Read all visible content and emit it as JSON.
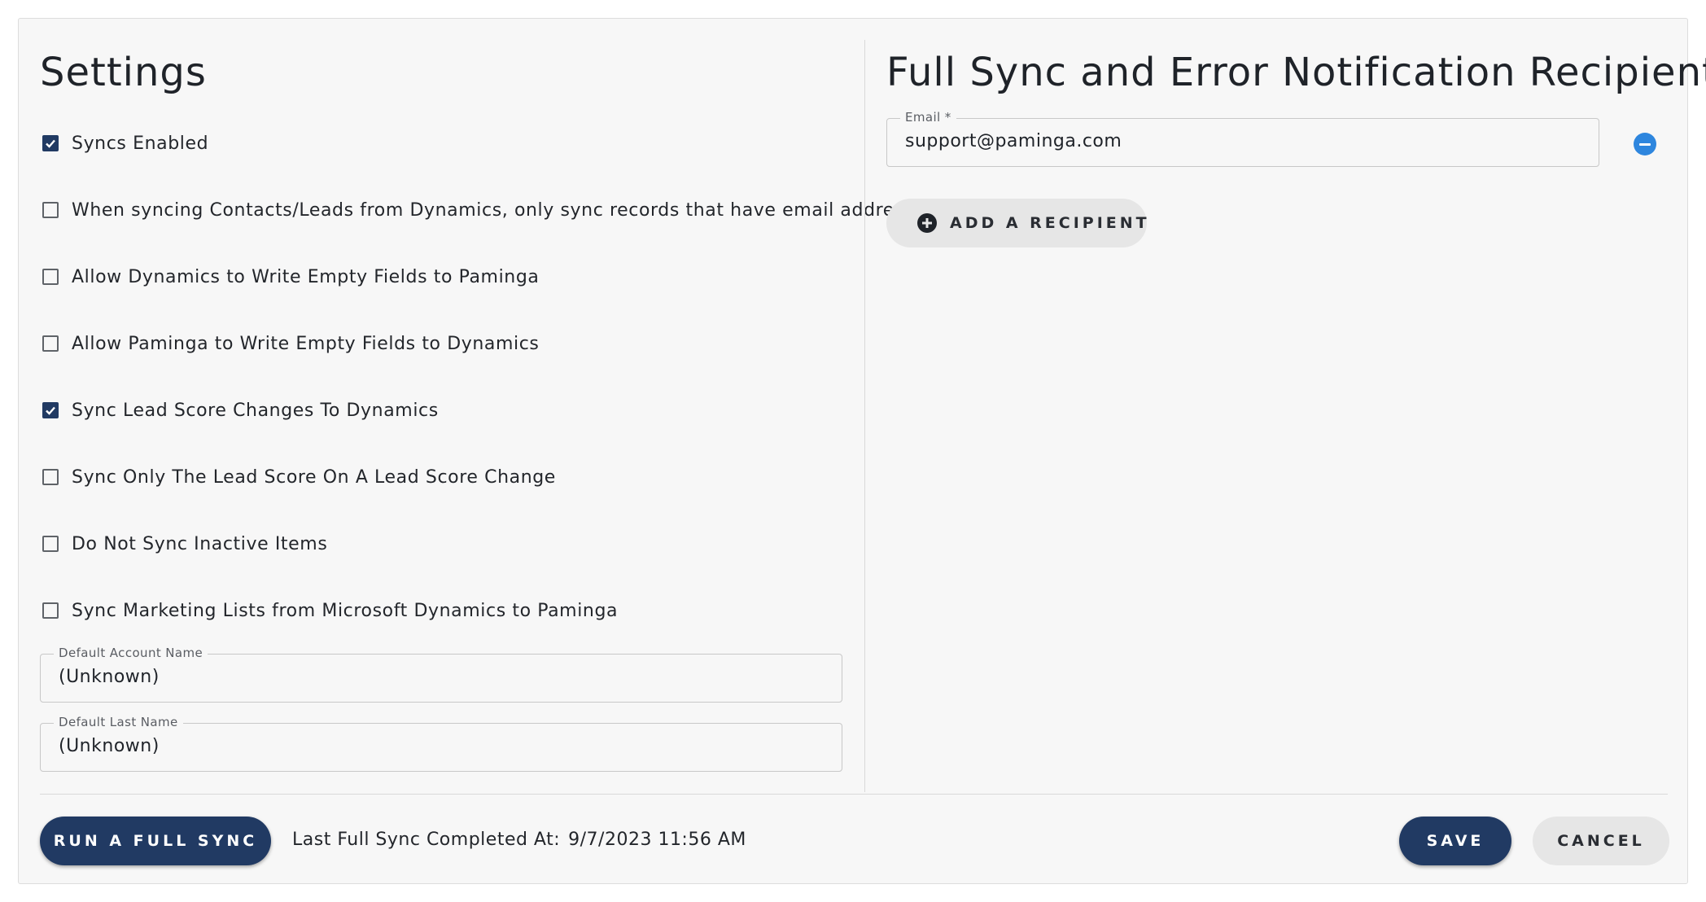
{
  "settings": {
    "title": "Settings",
    "checkboxes": [
      {
        "label": "Syncs Enabled",
        "checked": true
      },
      {
        "label": "When syncing Contacts/Leads from Dynamics, only sync records that have email addresses",
        "checked": false
      },
      {
        "label": "Allow Dynamics to Write Empty Fields to Paminga",
        "checked": false
      },
      {
        "label": "Allow Paminga to Write Empty Fields to Dynamics",
        "checked": false
      },
      {
        "label": "Sync Lead Score Changes To Dynamics",
        "checked": true
      },
      {
        "label": "Sync Only The Lead Score On A Lead Score Change",
        "checked": false
      },
      {
        "label": "Do Not Sync Inactive Items",
        "checked": false
      },
      {
        "label": "Sync Marketing Lists from Microsoft Dynamics to Paminga",
        "checked": false
      }
    ],
    "default_account_name": {
      "label": "Default Account Name",
      "value": "(Unknown)"
    },
    "default_last_name": {
      "label": "Default Last Name",
      "value": "(Unknown)"
    }
  },
  "recipients": {
    "title": "Full Sync and Error Notification Recipient(s)",
    "email": {
      "label": "Email *",
      "value": "support@paminga.com"
    },
    "add_label": "ADD A RECIPIENT"
  },
  "footer": {
    "run_label": "RUN A FULL SYNC",
    "last_sync_label": "Last Full Sync Completed At:",
    "last_sync_value": "9/7/2023 11:56 AM",
    "save_label": "SAVE",
    "cancel_label": "CANCEL"
  },
  "colors": {
    "primary": "#213a63",
    "accent_remove": "#2e86de",
    "secondary_button": "#e6e6e6",
    "panel_background": "#f7f7f7"
  }
}
